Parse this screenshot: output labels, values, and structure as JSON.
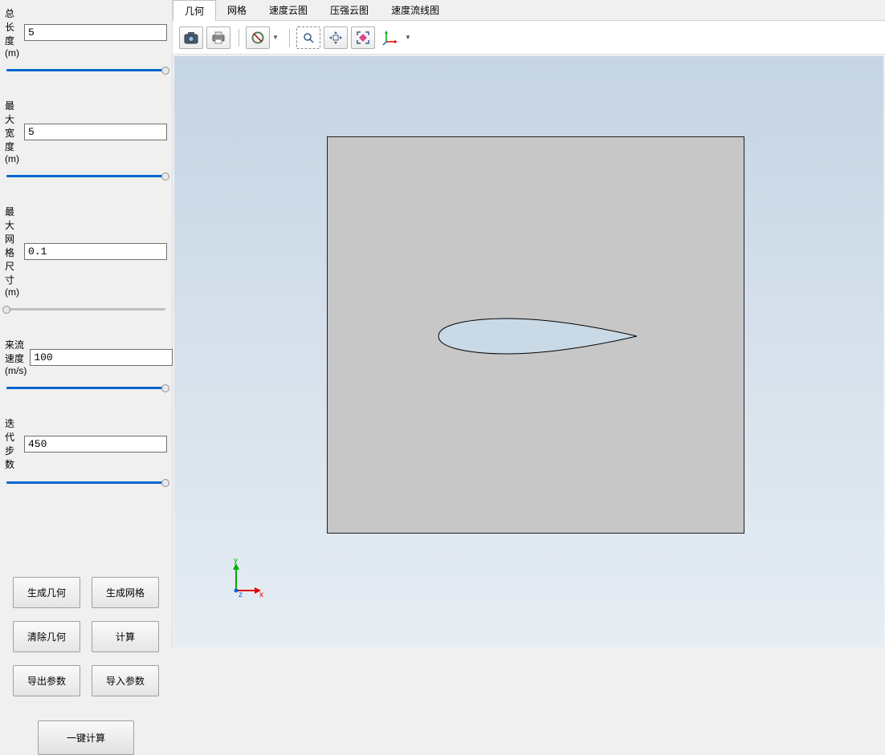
{
  "sidebar": {
    "params": [
      {
        "key": "total_length",
        "label": "总长度(m)",
        "value": "5",
        "fill_pct": 100
      },
      {
        "key": "max_width",
        "label": "最大宽度(m)",
        "value": "5",
        "fill_pct": 100
      },
      {
        "key": "max_mesh",
        "label": "最大网格尺寸(m)",
        "value": "0.1",
        "fill_pct": 0
      },
      {
        "key": "inflow_speed",
        "label": "来流速度(m/s)",
        "value": "100",
        "fill_pct": 100
      },
      {
        "key": "iter_steps",
        "label": "迭代步数",
        "value": "450",
        "fill_pct": 100
      }
    ],
    "buttons": {
      "gen_geom": "生成几何",
      "gen_mesh": "生成网格",
      "clear_geom": "清除几何",
      "compute": "计算",
      "export_params": "导出参数",
      "import_params": "导入参数",
      "one_click": "一键计算"
    }
  },
  "tabs": [
    {
      "key": "geom",
      "label": "几何",
      "active": true
    },
    {
      "key": "mesh",
      "label": "网格",
      "active": false
    },
    {
      "key": "vel_contour",
      "label": "速度云图",
      "active": false
    },
    {
      "key": "press_contour",
      "label": "压强云图",
      "active": false
    },
    {
      "key": "streamline",
      "label": "速度流线图",
      "active": false
    }
  ],
  "toolbar_icons": {
    "camera": "camera-icon",
    "print": "print-icon",
    "refresh": "refresh-icon",
    "zoom_box": "zoom-box-icon",
    "pan": "pan-icon",
    "fit": "fit-icon",
    "axes": "axes-icon"
  },
  "gizmo": {
    "x_label": "x",
    "y_label": "y",
    "z_label": "z"
  }
}
